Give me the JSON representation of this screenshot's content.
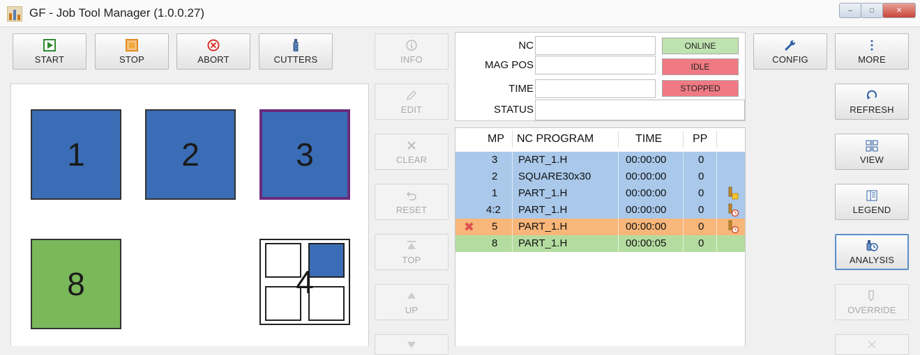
{
  "window": {
    "title": "GF - Job Tool Manager (1.0.0.27)"
  },
  "toolbar": {
    "start": "START",
    "stop": "STOP",
    "abort": "ABORT",
    "cutters": "CUTTERS"
  },
  "side_actions": [
    "INFO",
    "EDIT",
    "CLEAR",
    "RESET",
    "TOP",
    "UP"
  ],
  "status": {
    "labels": {
      "nc": "NC",
      "mag_pos": "MAG POS",
      "time": "TIME",
      "status": "STATUS"
    },
    "values": {
      "nc": "",
      "mag_pos": "",
      "time": "",
      "status": ""
    },
    "badges": {
      "online": "ONLINE",
      "idle": "IDLE",
      "stopped": "STOPPED"
    }
  },
  "right_buttons": {
    "config": "CONFIG",
    "more": "MORE",
    "refresh": "REFRESH",
    "view": "VIEW",
    "legend": "LEGEND",
    "analysis": "ANALYSIS",
    "override": "OVERRIDE"
  },
  "magazine": {
    "slots": [
      "1",
      "2",
      "3",
      "8",
      "4"
    ]
  },
  "program_table": {
    "headers": [
      "MP",
      "NC PROGRAM",
      "TIME",
      "PP"
    ],
    "rows": [
      {
        "mp": "3",
        "program": "PART_1.H",
        "time": "00:00:00",
        "pp": "0",
        "state": "blue",
        "icon": ""
      },
      {
        "mp": "2",
        "program": "SQUARE30x30",
        "time": "00:00:00",
        "pp": "0",
        "state": "blue",
        "icon": ""
      },
      {
        "mp": "1",
        "program": "PART_1.H",
        "time": "00:00:00",
        "pp": "0",
        "state": "blue",
        "icon": "tool-yellow-icon"
      },
      {
        "mp": "4:2",
        "program": "PART_1.H",
        "time": "00:00:00",
        "pp": "0",
        "state": "blue",
        "icon": "tool-clock-icon"
      },
      {
        "mp": "5",
        "program": "PART_1.H",
        "time": "00:00:00",
        "pp": "0",
        "state": "orange",
        "icon": "tool-clock-icon"
      },
      {
        "mp": "8",
        "program": "PART_1.H",
        "time": "00:00:05",
        "pp": "0",
        "state": "green",
        "icon": ""
      }
    ]
  },
  "colors": {
    "pallet_blue": "#3a6db5",
    "pallet_green": "#7ab85a",
    "selected_border": "#6a2b7c",
    "row_blue": "#a9c8ea",
    "row_orange": "#f8b67a",
    "row_green": "#b5dca0",
    "online": "#bfe3b0",
    "idle": "#f07a83",
    "stopped": "#f07a83"
  }
}
